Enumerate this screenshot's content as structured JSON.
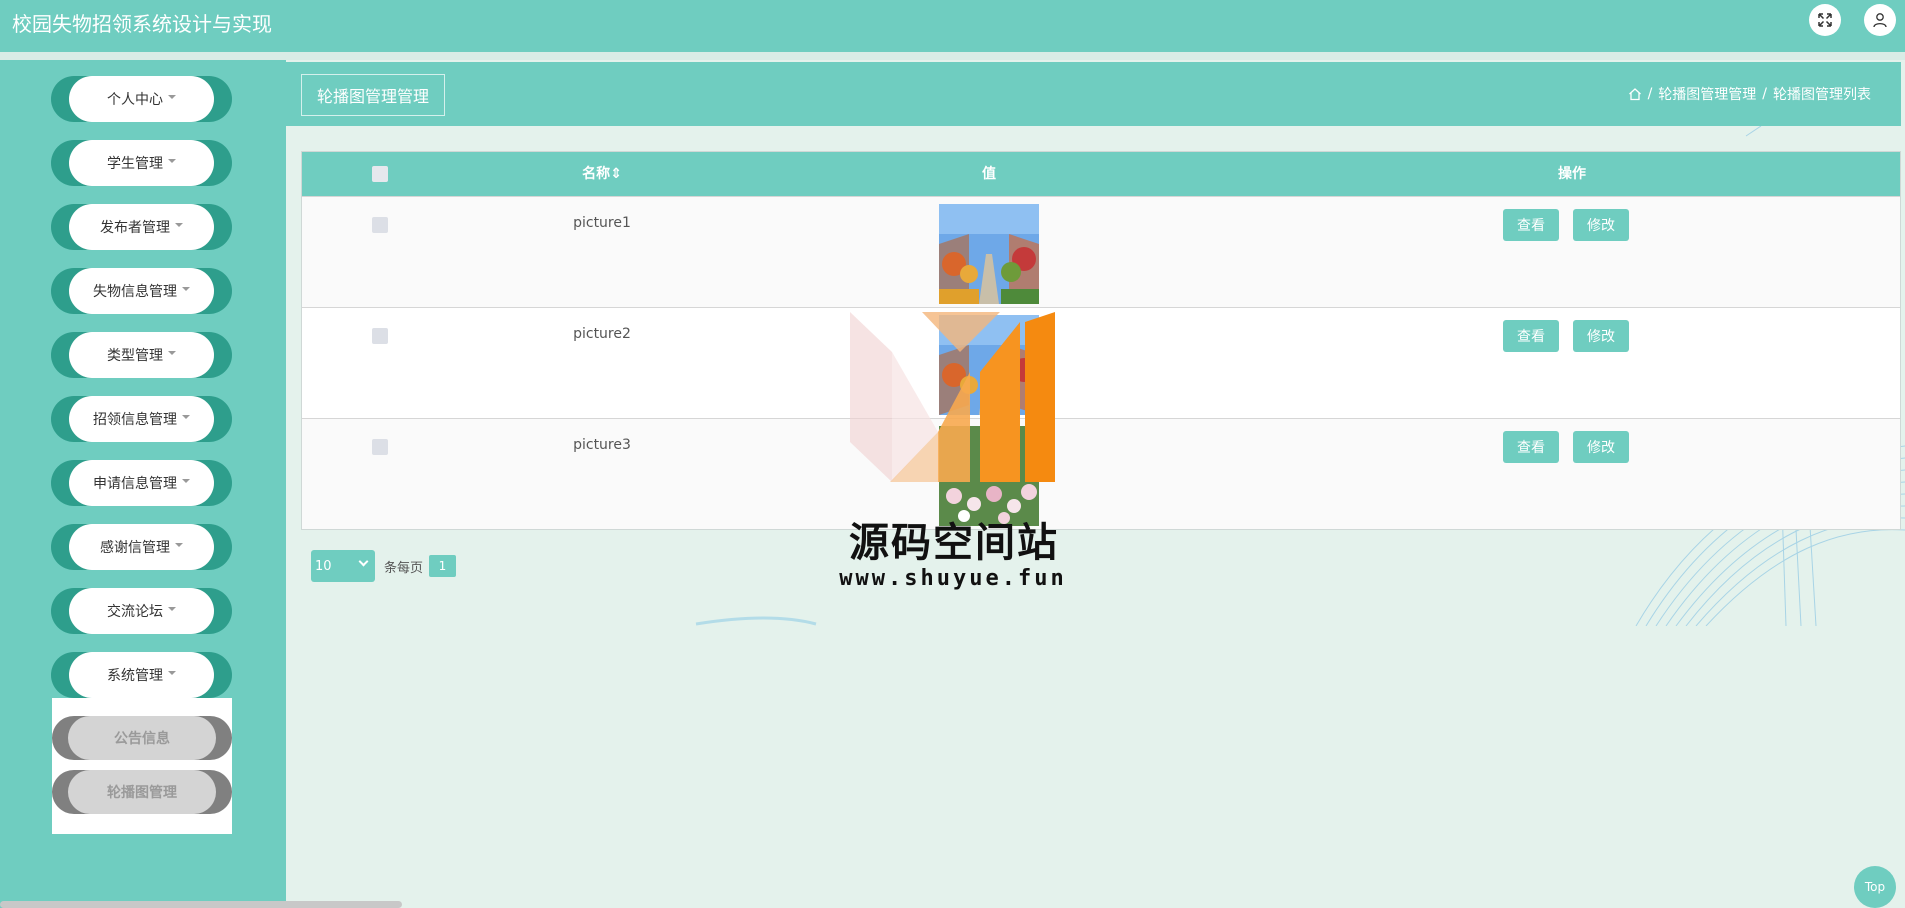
{
  "app": {
    "title": "校园失物招领系统设计与实现"
  },
  "header": {
    "fullscreen_icon": "expand-arrows-icon",
    "user_icon": "user-icon"
  },
  "sidebar": {
    "items": [
      {
        "label": "个人中心"
      },
      {
        "label": "学生管理"
      },
      {
        "label": "发布者管理"
      },
      {
        "label": "失物信息管理"
      },
      {
        "label": "类型管理"
      },
      {
        "label": "招领信息管理"
      },
      {
        "label": "申请信息管理"
      },
      {
        "label": "感谢信管理"
      },
      {
        "label": "交流论坛"
      },
      {
        "label": "系统管理"
      }
    ],
    "submenu": [
      {
        "label": "公告信息"
      },
      {
        "label": "轮播图管理"
      }
    ]
  },
  "page": {
    "tab_title": "轮播图管理管理",
    "breadcrumb": {
      "level1": "轮播图管理管理",
      "level2": "轮播图管理列表",
      "separator": "/"
    }
  },
  "table": {
    "headers": {
      "name": "名称",
      "value": "值",
      "actions": "操作"
    },
    "rows": [
      {
        "name": "picture1",
        "view": "查看",
        "edit": "修改"
      },
      {
        "name": "picture2",
        "view": "查看",
        "edit": "修改"
      },
      {
        "name": "picture3",
        "view": "查看",
        "edit": "修改"
      }
    ]
  },
  "pagination": {
    "page_size": "10",
    "per_page_label": "条每页",
    "current_page": "1"
  },
  "watermark": {
    "title": "源码空间站",
    "url": "www.shuyue.fun"
  },
  "back_to_top": "Top",
  "colors": {
    "primary": "#6fcdc0",
    "sidebar_dark": "#2e9e8c",
    "background": "#e4f2ec"
  }
}
